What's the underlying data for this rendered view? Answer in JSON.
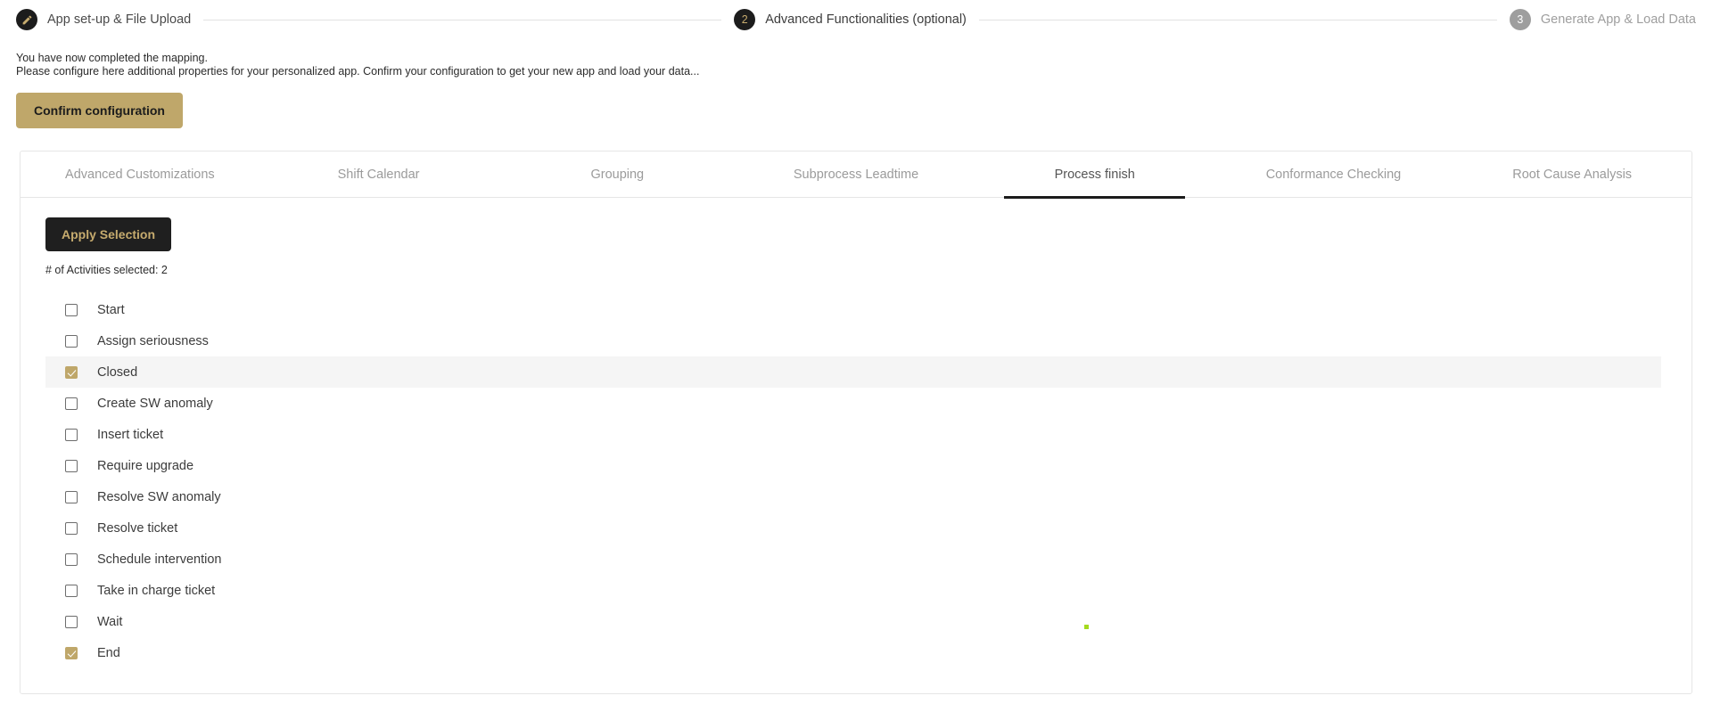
{
  "stepper": {
    "steps": [
      {
        "marker": "pencil-icon",
        "label": "App set-up & File Upload",
        "state": "done"
      },
      {
        "marker": "2",
        "label": "Advanced Functionalities (optional)",
        "state": "active"
      },
      {
        "marker": "3",
        "label": "Generate App & Load Data",
        "state": "todo"
      }
    ]
  },
  "intro": {
    "line1": "You have now completed the mapping.",
    "line2": "Please configure here additional properties for your personalized app. Confirm your configuration to get your new app and load your data...",
    "confirm_label": "Confirm configuration"
  },
  "tabs": [
    {
      "label": "Advanced Customizations",
      "active": false
    },
    {
      "label": "Shift Calendar",
      "active": false
    },
    {
      "label": "Grouping",
      "active": false
    },
    {
      "label": "Subprocess Leadtime",
      "active": false
    },
    {
      "label": "Process finish",
      "active": true
    },
    {
      "label": "Conformance Checking",
      "active": false
    },
    {
      "label": "Root Cause Analysis",
      "active": false
    }
  ],
  "panel": {
    "apply_label": "Apply Selection",
    "count_text": "# of Activities selected: 2",
    "activities": [
      {
        "label": "Start",
        "checked": false,
        "highlight": false
      },
      {
        "label": "Assign seriousness",
        "checked": false,
        "highlight": false
      },
      {
        "label": "Closed",
        "checked": true,
        "highlight": true
      },
      {
        "label": "Create SW anomaly",
        "checked": false,
        "highlight": false
      },
      {
        "label": "Insert ticket",
        "checked": false,
        "highlight": false
      },
      {
        "label": "Require upgrade",
        "checked": false,
        "highlight": false
      },
      {
        "label": "Resolve SW anomaly",
        "checked": false,
        "highlight": false
      },
      {
        "label": "Resolve ticket",
        "checked": false,
        "highlight": false
      },
      {
        "label": "Schedule intervention",
        "checked": false,
        "highlight": false
      },
      {
        "label": "Take in charge ticket",
        "checked": false,
        "highlight": false
      },
      {
        "label": "Wait",
        "checked": false,
        "highlight": false
      },
      {
        "label": "End",
        "checked": true,
        "highlight": false
      }
    ]
  },
  "colors": {
    "accent_gold": "#bfa76a",
    "dark": "#1c1c1c",
    "tab_active_underline": "#1c1c1c",
    "green_dot": "#a4da1e"
  }
}
